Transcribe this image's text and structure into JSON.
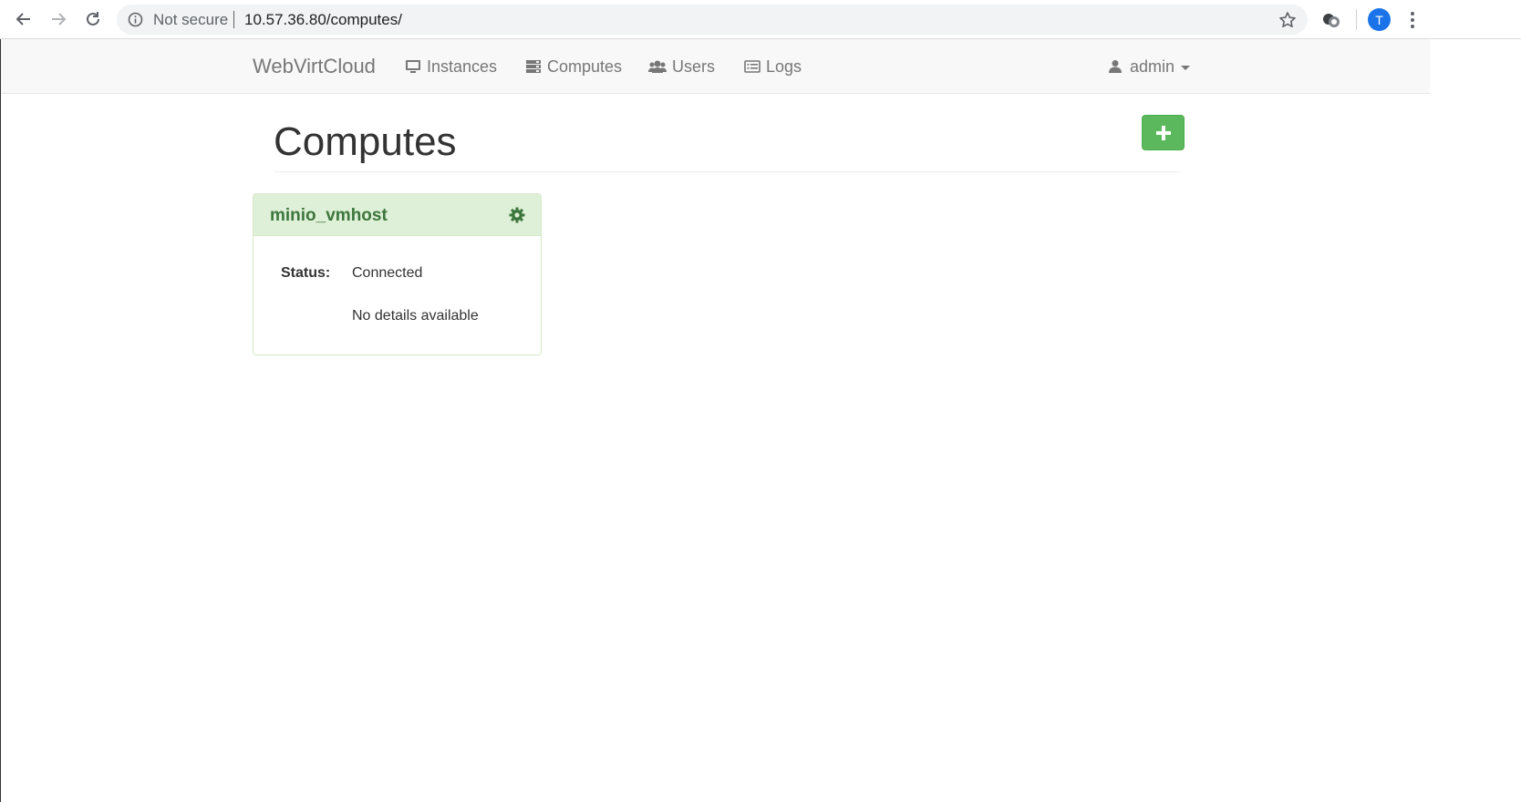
{
  "browser": {
    "security_label": "Not secure",
    "url": "10.57.36.80/computes/",
    "profile_initial": "T"
  },
  "navbar": {
    "brand": "WebVirtCloud",
    "links": [
      {
        "label": "Instances",
        "icon": "monitor-icon"
      },
      {
        "label": "Computes",
        "icon": "server-icon"
      },
      {
        "label": "Users",
        "icon": "users-icon"
      },
      {
        "label": "Logs",
        "icon": "list-icon"
      }
    ],
    "user": {
      "label": "admin",
      "icon": "user-icon"
    }
  },
  "page": {
    "title": "Computes",
    "add_button_icon": "plus-icon"
  },
  "computes": [
    {
      "name": "minio_vmhost",
      "status_label": "Status:",
      "status_value": "Connected",
      "details": "No details available",
      "settings_icon": "gear-icon"
    }
  ],
  "colors": {
    "success": "#5cb85c",
    "panel_heading_bg": "#dff0d8",
    "panel_title": "#3c763d",
    "navbar_bg": "#f8f8f8",
    "profile_avatar": "#1a73e8"
  }
}
